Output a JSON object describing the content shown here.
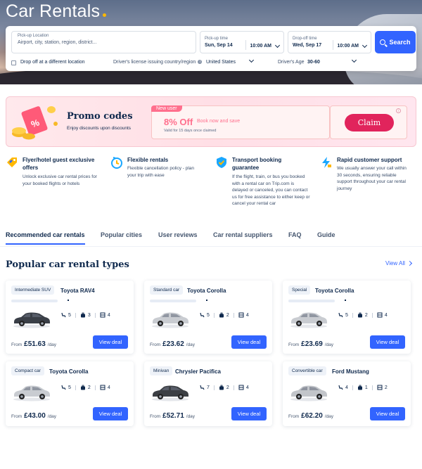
{
  "hero": {
    "title": "Car Rentals"
  },
  "search": {
    "pickup_label": "Pick-up Location",
    "pickup_placeholder": "Airport, city, station, region, district...",
    "pickup_time_label": "Pick-up time",
    "pickup_date": "Sun, Sep 14",
    "pickup_time": "10:00 AM",
    "dropoff_time_label": "Drop-off time",
    "dropoff_date": "Wed, Sep 17",
    "dropoff_time": "10:00 AM",
    "search_label": "Search",
    "drop_off_different": "Drop off at a different location",
    "license_label": "Driver's license issuing country/region",
    "license_value": "United States",
    "age_label": "Driver's Age",
    "age_value": "30-60"
  },
  "promo": {
    "title": "Promo codes",
    "subtitle": "Enjoy discounts upon discounts",
    "tag": "New user",
    "discount": "8% Off",
    "book": "Book now and save",
    "validity": "Valid for 15 days once claimed",
    "claim_label": "Claim"
  },
  "features": [
    {
      "title": "Flyer/hotel guest exclusive offers",
      "desc": "Unlock exclusive car rental prices for your booked flights or hotels"
    },
    {
      "title": "Flexible rentals",
      "desc": "Flexible cancellation policy - plan your trip with ease"
    },
    {
      "title": "Transport booking guarantee",
      "desc": "If the flight, train, or bus you booked with a rental car on Trip.com is delayed or canceled, you can contact us for free assistance to either keep or cancel your rental car"
    },
    {
      "title": "Rapid customer support",
      "desc": "We usually answer your call within 30 seconds, ensuring reliable support throughout your car rental journey"
    }
  ],
  "tabs": [
    "Recommended car rentals",
    "Popular cities",
    "User reviews",
    "Car rental suppliers",
    "FAQ",
    "Guide"
  ],
  "section": {
    "title": "Popular car rental types",
    "view_all": "View All"
  },
  "cards": [
    {
      "type": "Intermediate SUV",
      "model": "Toyota RAV4",
      "seats": "5",
      "bags": "3",
      "doors": "4",
      "from": "From",
      "price": "£51.63",
      "per": "/day",
      "deal": "View deal",
      "color": "#3a3f47"
    },
    {
      "type": "Standard car",
      "model": "Toyota Corolla",
      "seats": "5",
      "bags": "2",
      "doors": "4",
      "from": "From",
      "price": "£23.62",
      "per": "/day",
      "deal": "View deal",
      "color": "#c9ccd1"
    },
    {
      "type": "Special",
      "model": "Toyota Corolla",
      "seats": "5",
      "bags": "2",
      "doors": "4",
      "from": "From",
      "price": "£23.69",
      "per": "/day",
      "deal": "View deal",
      "color": "#c9ccd1"
    },
    {
      "type": "Compact car",
      "model": "Toyota Corolla",
      "seats": "5",
      "bags": "2",
      "doors": "4",
      "from": "From",
      "price": "£43.00",
      "per": "/day",
      "deal": "View deal",
      "color": "#c9ccd1"
    },
    {
      "type": "Minivan",
      "model": "Chrysler Pacifica",
      "seats": "7",
      "bags": "2",
      "doors": "4",
      "from": "From",
      "price": "£52.71",
      "per": "/day",
      "deal": "View deal",
      "color": "#3c3f44"
    },
    {
      "type": "Convertible car",
      "model": "Ford Mustang",
      "seats": "4",
      "bags": "1",
      "doors": "2",
      "from": "From",
      "price": "£62.20",
      "per": "/day",
      "deal": "View deal",
      "color": "#c2c5ca"
    }
  ]
}
